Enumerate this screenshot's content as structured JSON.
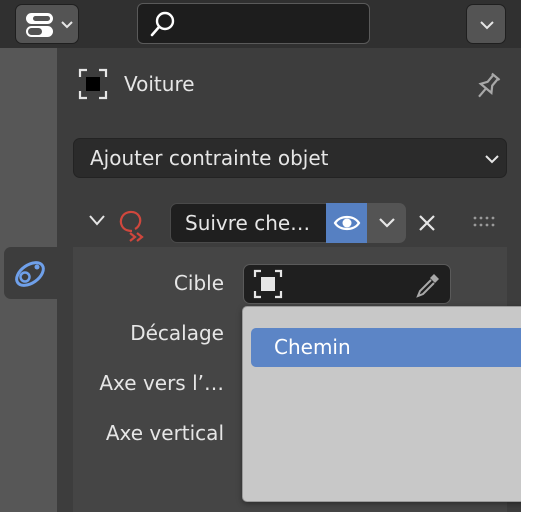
{
  "object": {
    "name": "Voiture"
  },
  "add_constraint": {
    "label": "Ajouter contrainte objet"
  },
  "constraint": {
    "name": "Suivre che…",
    "fields": {
      "target": "Cible",
      "offset": "Décalage",
      "forward_axis": "Axe vers l’…",
      "up_axis": "Axe vertical"
    }
  },
  "target_dropdown": {
    "items": [
      "Chemin"
    ]
  },
  "colors": {
    "accent": "#5680c2",
    "highlight": "#5c85c6",
    "constraint_icon": "#d0473d"
  }
}
